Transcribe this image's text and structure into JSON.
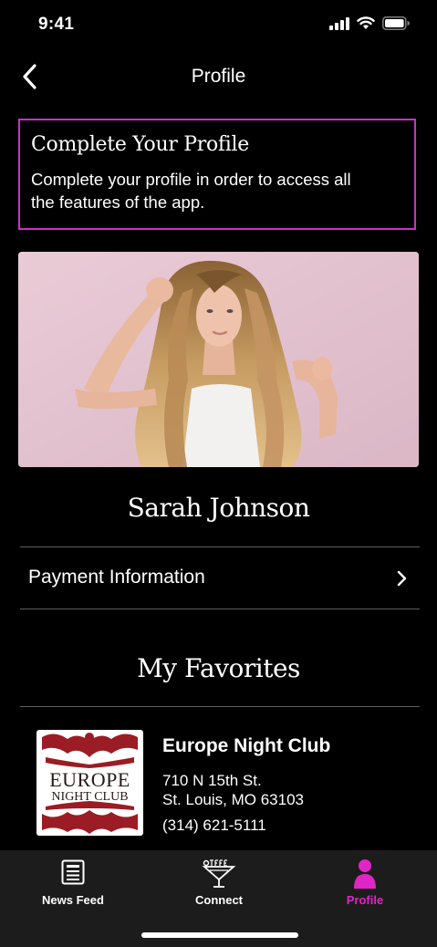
{
  "status_bar": {
    "time": "9:41"
  },
  "nav": {
    "title": "Profile"
  },
  "complete_profile": {
    "title": "Complete Your Profile",
    "message": "Complete your profile in order to access all the features of the app."
  },
  "profile": {
    "name": "Sarah Johnson"
  },
  "menu": {
    "payment_label": "Payment Information"
  },
  "favorites": {
    "title": "My Favorites",
    "items": [
      {
        "logo_main": "EUROPE",
        "logo_sub": "NIGHT CLUB",
        "name": "Europe Night Club",
        "address_line1": "710 N 15th St.",
        "address_line2": "St. Louis, MO 63103",
        "phone": "(314) 621-5111"
      }
    ]
  },
  "tabs": [
    {
      "label": "News Feed",
      "icon": "news-feed-icon"
    },
    {
      "label": "Connect",
      "icon": "cocktail-icon"
    },
    {
      "label": "Profile",
      "icon": "person-icon"
    }
  ],
  "colors": {
    "accent": "#e025c6",
    "card_border": "#c932c6",
    "background": "#000000",
    "tab_bar": "#1c1c1c"
  }
}
